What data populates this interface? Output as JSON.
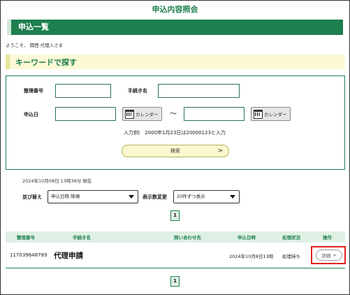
{
  "app": {
    "title": "申込内容照会"
  },
  "section": {
    "title": "申込一覧"
  },
  "user": {
    "welcome": "ようこそ、 関西 代理人さま"
  },
  "keyword": {
    "title": "キーワードで探す",
    "ref_label": "整理番号",
    "ref_value": "",
    "proc_label": "手続き名",
    "proc_value": "",
    "date_label": "申込日",
    "date_from": "",
    "date_to": "",
    "calendar_label": "カレンダー",
    "tilde": "～",
    "hint": "入力例） 2000年1月23日は20000123と入力",
    "search_label": "検索",
    "search_arrow": ">"
  },
  "list": {
    "timestamp": "2024年10月08日 13時39分 現在",
    "sort_label": "並び替え",
    "sort_value": "申込日時 降順",
    "count_label": "表示数変更",
    "count_value": "20件ずつ表示",
    "page": "1"
  },
  "table": {
    "headers": [
      "整理番号",
      "手続き名",
      "問い合わせ先",
      "申込日時",
      "処理状況",
      "操作"
    ],
    "rows": [
      {
        "ref": "117039648789",
        "procedure": "代理申請",
        "contact": "",
        "date": "2024年10月8日13時",
        "status": "処理待ち",
        "action": "詳細",
        "action_arrow": ">"
      }
    ]
  },
  "colors": {
    "accent": "#1e7f4f",
    "highlight": "#e02020",
    "button_bg": "#fbf8cf"
  }
}
